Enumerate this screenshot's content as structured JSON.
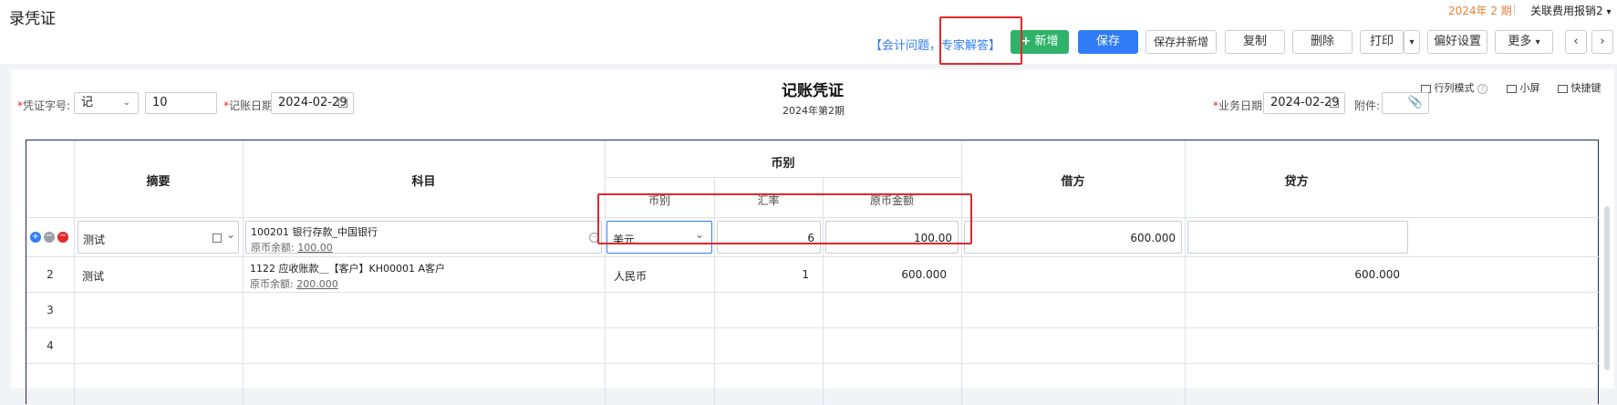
{
  "page_title": "录凭证",
  "period_label": "2024年 2 期",
  "report_menu": "关联费用报销2",
  "help_link": "【会计问题，专家解答】",
  "toolbar": {
    "add_label": "新增",
    "save_label": "保存",
    "save_new_label": "保存并新增",
    "copy_label": "复制",
    "delete_label": "删除",
    "print_label": "打印",
    "prefs_label": "偏好设置",
    "more_label": "更多"
  },
  "voucher": {
    "title": "记账凭证",
    "period": "2024年第2期",
    "word_label": "凭证字号:",
    "word_value": "记",
    "number_value": "10",
    "date_label": "记账日期:",
    "date_value": "2024-02-29",
    "biz_date_label": "业务日期:",
    "biz_date_value": "2024-02-29",
    "attach_label": "附件:",
    "row_col_mode": "行列模式",
    "small_screen": "小屏",
    "shortcut": "快捷键"
  },
  "table": {
    "headers": {
      "summary": "摘要",
      "subject": "科目",
      "currency_group": "币别",
      "currency": "币别",
      "rate": "汇率",
      "orig_amount": "原币金额",
      "debit": "借方",
      "credit": "贷方"
    },
    "rows": [
      {
        "num": "",
        "summary": "测试",
        "subject": "100201 银行存款_中国银行",
        "balance_label": "原币余额:",
        "balance": "100.00",
        "currency": "美元",
        "rate": "6",
        "orig_amount": "100.00",
        "debit": "600.000",
        "credit": ""
      },
      {
        "num": "2",
        "summary": "测试",
        "subject": "1122 应收账款＿【客户】KH00001 A客户",
        "balance_label": "原币余额:",
        "balance": "200.000",
        "currency": "人民币",
        "rate": "1",
        "orig_amount": "600.000",
        "debit": "",
        "credit": "600.000"
      },
      {
        "num": "3"
      },
      {
        "num": "4"
      }
    ]
  },
  "colors": {
    "accent": "#2f7cf6",
    "green": "#2fb36a",
    "highlight": "#e5262b",
    "period": "#e8823a"
  }
}
